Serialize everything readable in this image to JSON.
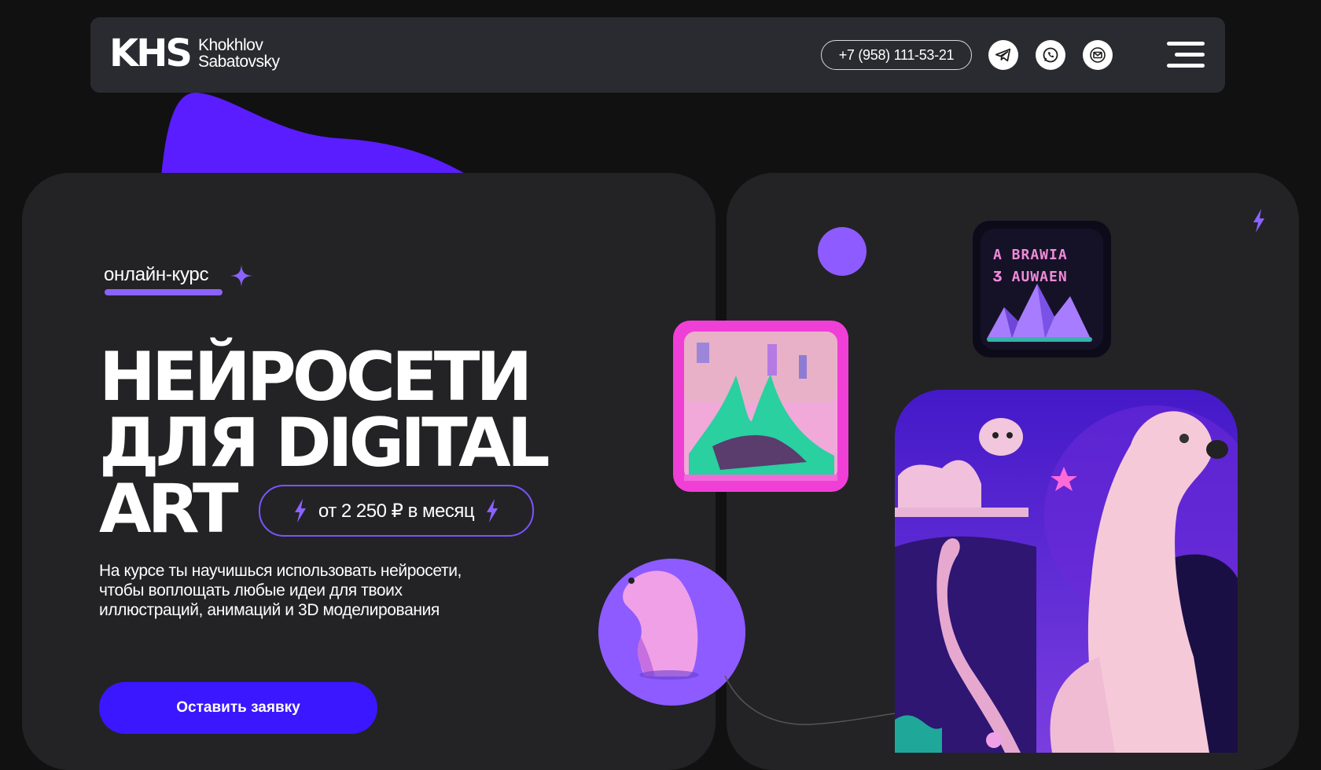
{
  "header": {
    "logo_mark": "KHS",
    "logo_line1": "Khokhlov",
    "logo_line2": "Sabatovsky",
    "phone": "+7 (958) 111-53-21"
  },
  "hero": {
    "tag": "онлайн-курс",
    "title_line1": "НЕЙРОСЕТИ",
    "title_line2": "ДЛЯ DIGITAL",
    "title_line3": "ART",
    "price": "от 2 250 ₽ в месяц",
    "description": "На курсе ты научишься использовать нейросети, чтобы воплощать любые идеи для твоих иллюстраций, анимаций и 3D моделирования",
    "cta_label": "Оставить заявку"
  },
  "artwork": {
    "poster_text_line1": "A BRAWIA",
    "poster_text_line2": "Ӡ AUWAEN"
  },
  "colors": {
    "accent": "#8b62ff",
    "cta": "#3a17ff",
    "card": "#232325",
    "header": "#2a2b30",
    "background": "#111112"
  },
  "icons": [
    "telegram-icon",
    "whatsapp-icon",
    "mail-icon",
    "menu-icon",
    "lightning-icon",
    "sparkle-icon"
  ]
}
